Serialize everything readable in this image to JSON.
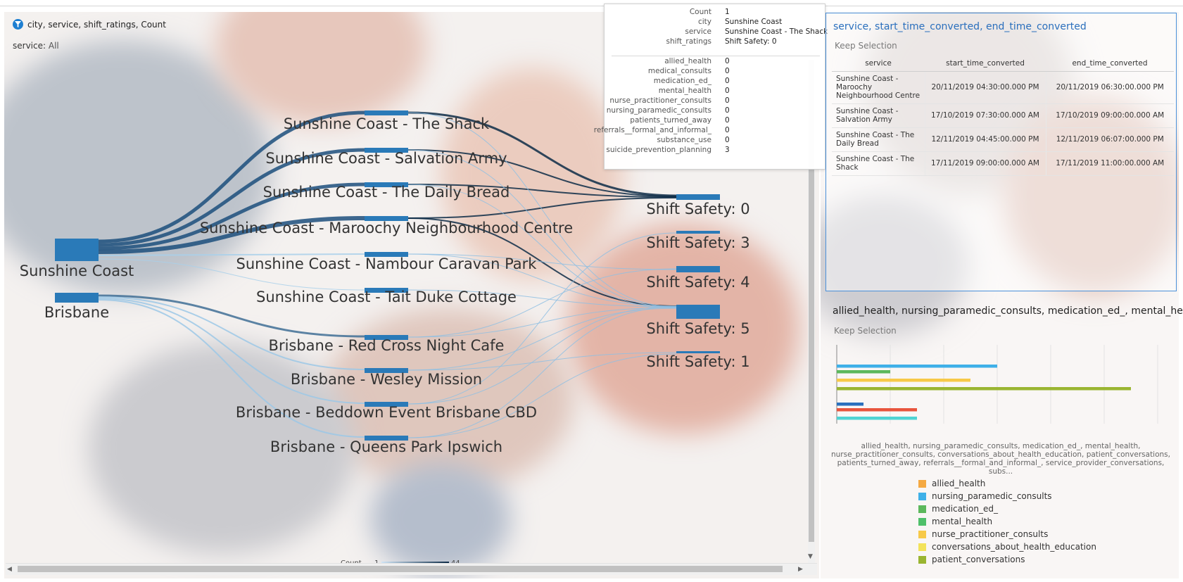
{
  "sankey": {
    "title": "city, service, shift_ratings, Count",
    "filter_label": "service:",
    "filter_value": "All",
    "cities": [
      "Sunshine Coast",
      "Brisbane"
    ],
    "services": [
      "Sunshine Coast - The Shack",
      "Sunshine Coast - Salvation Army",
      "Sunshine Coast - The Daily Bread",
      "Sunshine Coast - Maroochy Neighbourhood Centre",
      "Sunshine Coast - Nambour Caravan Park",
      "Sunshine Coast - Tait Duke Cottage",
      "Brisbane - Red Cross Night Cafe",
      "Brisbane - Wesley Mission",
      "Brisbane - Beddown Event Brisbane CBD",
      "Brisbane - Queens Park Ipswich"
    ],
    "ratings": [
      "Shift Safety: 0",
      "Shift Safety: 3",
      "Shift Safety: 4",
      "Shift Safety: 5",
      "Shift Safety: 1"
    ],
    "count_legend": {
      "label": "Count",
      "min": "1",
      "max": "44"
    },
    "colors": {
      "node": "#2a7ab8",
      "link_dark": "#0d2b47",
      "link_light": "#9fcbe8"
    }
  },
  "tooltip": {
    "head": [
      {
        "k": "Count",
        "v": "1"
      },
      {
        "k": "city",
        "v": "Sunshine Coast"
      },
      {
        "k": "service",
        "v": "Sunshine Coast - The Shack"
      },
      {
        "k": "shift_ratings",
        "v": "Shift Safety: 0"
      }
    ],
    "body": [
      {
        "k": "allied_health",
        "v": "0"
      },
      {
        "k": "medical_consults",
        "v": "0"
      },
      {
        "k": "medication_ed_",
        "v": "0"
      },
      {
        "k": "mental_health",
        "v": "0"
      },
      {
        "k": "nurse_practitioner_consults",
        "v": "0"
      },
      {
        "k": "nursing_paramedic_consults",
        "v": "0"
      },
      {
        "k": "patients_turned_away",
        "v": "0"
      },
      {
        "k": "referrals__formal_and_informal_",
        "v": "0"
      },
      {
        "k": "substance_use",
        "v": "0"
      },
      {
        "k": "suicide_prevention_planning",
        "v": "3"
      }
    ]
  },
  "table_panel": {
    "title": "service, start_time_converted, end_time_converted",
    "keep": "Keep Selection",
    "headers": [
      "service",
      "start_time_converted",
      "end_time_converted"
    ],
    "rows": [
      [
        "Sunshine Coast - Maroochy Neighbourhood Centre",
        "20/11/2019 04:30:00.000 PM",
        "20/11/2019 06:30:00.000 PM"
      ],
      [
        "Sunshine Coast - Salvation Army",
        "17/10/2019 07:30:00.000 AM",
        "17/10/2019 09:00:00.000 AM"
      ],
      [
        "Sunshine Coast - The Daily Bread",
        "12/11/2019 04:45:00.000 PM",
        "12/11/2019 06:07:00.000 PM"
      ],
      [
        "Sunshine Coast - The Shack",
        "17/11/2019 09:00:00.000 AM",
        "17/11/2019 11:00:00.000 AM"
      ]
    ]
  },
  "bar_panel": {
    "title": "allied_health, nursing_paramedic_consults, medication_ed_, mental_hea...",
    "keep": "Keep Selection",
    "axis_caption": [
      "allied_health, nursing_paramedic_consults, medication_ed_, mental_health,",
      "nurse_practitioner_consults, conversations_about_health_education, patient_conversations,",
      "patients_turned_away, referrals__formal_and_informal_, service_provider_conversations, subs..."
    ],
    "legend": [
      {
        "label": "allied_health",
        "color": "#f5a942"
      },
      {
        "label": "nursing_paramedic_consults",
        "color": "#3fb0e8"
      },
      {
        "label": "medication_ed_",
        "color": "#5cb85c"
      },
      {
        "label": "mental_health",
        "color": "#4fc06a"
      },
      {
        "label": "nurse_practitioner_consults",
        "color": "#f7c948"
      },
      {
        "label": "conversations_about_health_education",
        "color": "#f3e35a"
      },
      {
        "label": "patient_conversations",
        "color": "#9ab531"
      }
    ]
  },
  "chart_data": {
    "type": "bar",
    "orientation": "horizontal",
    "title": "allied_health, nursing_paramedic_consults, medication_ed_, mental_hea...",
    "series": [
      {
        "color": "#3fb0e8",
        "value": 30
      },
      {
        "color": "#5cb85c",
        "value": 10
      },
      {
        "color": "#f7c948",
        "value": 25
      },
      {
        "color": "#9ab531",
        "value": 55
      },
      {
        "color": "#2a6fbd",
        "value": 5
      },
      {
        "color": "#e8543c",
        "value": 15
      },
      {
        "color": "#4fd3d3",
        "value": 15
      }
    ],
    "xlim": [
      0,
      60
    ],
    "grid": true
  }
}
